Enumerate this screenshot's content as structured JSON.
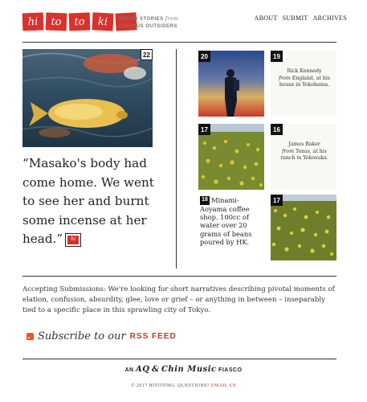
{
  "header": {
    "logo_syllables": [
      "hi",
      "to",
      "to",
      "ki",
      ""
    ],
    "tagline_line1": "TOKYO STORIES",
    "tagline_from": "from",
    "tagline_line2": "CURIOUS OUTSIDERS",
    "nav": [
      "ABOUT",
      "SUBMIT",
      "ARCHIVES"
    ]
  },
  "feature": {
    "number": "22",
    "quote": "“Masako's body had come home. We went to see her and burnt some incense at her head.”",
    "quote_icon_text": "hi"
  },
  "tiles": [
    {
      "number": "20",
      "kind": "image"
    },
    {
      "number": "19",
      "kind": "text",
      "name": "Rick Kennedy",
      "from_word": "from",
      "detail": "England, at his house in Yokohama."
    },
    {
      "number": "17",
      "kind": "image"
    },
    {
      "number": "16",
      "kind": "text",
      "name": "James Baker",
      "from_word": "from",
      "detail": "Texas, at his ranch in Yokosuka."
    },
    {
      "number": "18",
      "kind": "quote",
      "quote": "Minami-Aoyama coffee shop. 100cc of water over 20 grams of beans poured by HK."
    },
    {
      "number": "17",
      "kind": "image"
    }
  ],
  "submissions": "Accepting Submissions: We're looking for short narratives describing pivotal moments of elation, confusion, absurdity, glee, love or grief – or anything in between – inseparably tied to a specific place in this sprawling city of Tokyo.",
  "subscribe": {
    "text": "Subscribe to our",
    "link": "RSS FEED"
  },
  "footer": {
    "credit_prefix": "AN",
    "credit_aq": "AQ",
    "credit_amp": "&",
    "credit_chin": "Chin Music",
    "credit_suffix": "FIASCO",
    "copyright": "© 2017 HITOTOKI. QUESTIONS?",
    "email_link": "EMAIL US"
  },
  "colors": {
    "brand_red": "#d9322c",
    "rss_orange": "#e65a1f",
    "link_red": "#c0392b"
  }
}
